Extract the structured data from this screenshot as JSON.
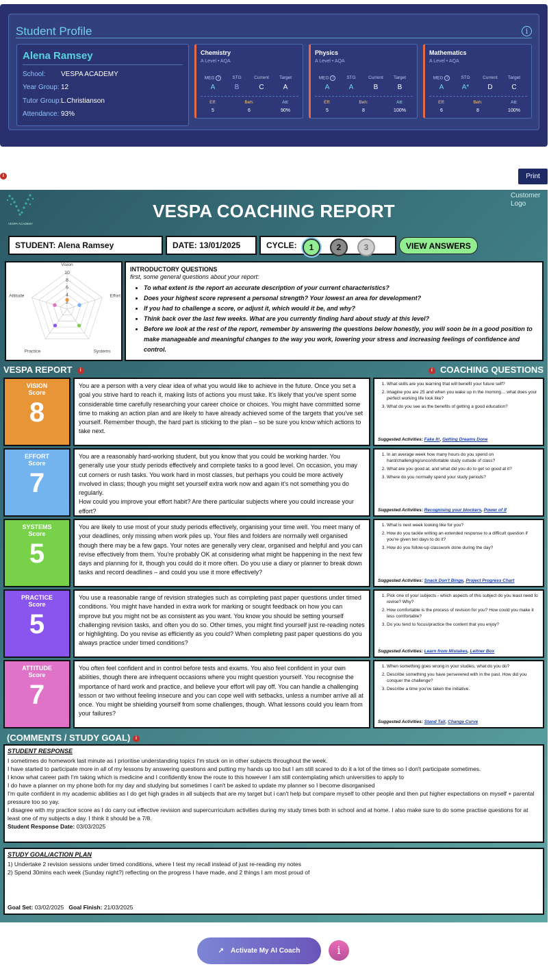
{
  "profile": {
    "title": "Student Profile",
    "name": "Alena Ramsey",
    "fields": [
      {
        "label": "School:",
        "value": "VESPA ACADEMY"
      },
      {
        "label": "Year Group:",
        "value": "12"
      },
      {
        "label": "Tutor Group:",
        "value": "L.Christianson"
      },
      {
        "label": "Attendance:",
        "value": "93%"
      }
    ],
    "headers": {
      "meg": "MEG",
      "stg": "STG",
      "current": "Current",
      "target": "Target",
      "eff": "Eff:",
      "beh": "Beh:",
      "att": "Att:"
    },
    "subjects": [
      {
        "name": "Chemistry",
        "level": "A Level • AQA",
        "meg": "A",
        "stg": "B",
        "current": "C",
        "target": "A",
        "eff": "5",
        "beh": "6",
        "att": "90%"
      },
      {
        "name": "Physics",
        "level": "A Level • AQA",
        "meg": "A",
        "stg": "A",
        "current": "B",
        "target": "B",
        "eff": "5",
        "beh": "8",
        "att": "100%"
      },
      {
        "name": "Mathematics",
        "level": "A Level • AQA",
        "meg": "A",
        "stg": "A*",
        "current": "D",
        "target": "C",
        "eff": "6",
        "beh": "8",
        "att": "100%"
      }
    ]
  },
  "print_label": "Print",
  "report": {
    "logo_text": "VESPA ACADEMY",
    "title": "VESPA COACHING REPORT",
    "customer_logo": "Customer Logo",
    "student_field": "STUDENT: Alena Ramsey",
    "date_field": "DATE: 13/01/2025",
    "cycle_label": "CYCLE:",
    "cycles": [
      "1",
      "2",
      "3"
    ],
    "view_answers": "VIEW ANSWERS",
    "intro": {
      "title": "INTRODUCTORY QUESTIONS",
      "subtitle": "first, some general questions about your report:",
      "questions": [
        "To what extent is the report an accurate description of your current characteristics?",
        "Does your highest score represent a personal strength? Your lowest an area for development?",
        "If you had to challenge a score, or adjust it, which would it be, and why?",
        "Think back over the last few weeks. What are you currently finding hard about study at this level?",
        "Before we look at the rest of the report, remember by answering the questions below honestly, you will soon be in a good position to make manageable and meaningful changes to the way you work, lowering your stress and increasing feelings of confidence and control."
      ]
    },
    "vespa_report_label": "VESPA REPORT",
    "coaching_questions_label": "COACHING QUESTIONS",
    "score_label": "Score",
    "suggested_label": "Suggested Activities:",
    "sections": [
      {
        "key": "vision",
        "title": "VISION",
        "score": "8",
        "color": "#e89538",
        "text": "You are a person with a very clear idea of what you would like to achieve in the future. Once you set a goal you strive hard to reach it, making lists of actions you must take. It's likely that you've spent some considerable time carefully researching your career choice or choices. You might have committed some time to making an action plan and are likely to have already achieved some of the targets that you've set yourself. Remember though, the hard part is sticking to the plan – so be sure you know which actions to take next.",
        "questions": [
          "What skills are you learning that will benefit your future self?",
          "Imagine you are 25 and when you wake up in the morning… what does your perfect working life look like?",
          "What do you see as the benefits of getting a good education?"
        ],
        "activities": [
          "Fake It!",
          "Getting Dreams Done"
        ]
      },
      {
        "key": "effort",
        "title": "EFFORT",
        "score": "7",
        "color": "#73b3f0",
        "text": "You are a reasonably hard-working student, but you know that you could be working harder. You generally use your study periods effectively and complete tasks to a good level. On occasion, you may cut corners or rush tasks. You work hard in most classes, but perhaps you could be more actively involved in class; though you might set yourself extra work now and again it's not something you do regularly.\nHow could you improve your effort habit? Are there particular subjects  where you could increase your effort?",
        "questions": [
          "In an average week how many hours do you spend on hard/challenging/uncomfortable study outside of class?",
          "What are you good at, and what did you do to get so good at it?",
          "Where do you normally spend your study periods?"
        ],
        "activities": [
          "Recognising your blockers",
          "Power of If"
        ]
      },
      {
        "key": "systems",
        "title": "SYSTEMS",
        "score": "5",
        "color": "#77d24a",
        "text": "You are likely to use most of your study periods effectively, organising your time well. You meet many of your deadlines, only missing when work piles up. Your files and folders are normally well organised though there may be a few gaps. Your notes are generally very clear, organised and helpful and you can revise effectively from them. You're probably OK at considering what might be happening in the next few days and planning for it, though you could do it more often. Do you use a diary or planner to break down tasks and record deadlines – and could you use it more effectively?",
        "questions": [
          "What is next week looking like for you?",
          "How do you tackle writing an extended response to a difficult question if you're given ten days to do it?",
          "How do you follow-up classwork done during the day?"
        ],
        "activities": [
          "Snack Don't Binge",
          "Project Progress Chart"
        ]
      },
      {
        "key": "practice",
        "title": "PRACTICE",
        "score": "5",
        "color": "#8a55ee",
        "text": "You use a reasonable range of revision strategies such as completing past paper questions under timed conditions. You might have handed in extra work for marking or sought feedback on how you can improve but you might not be as consistent as you want. You know you should be setting yourself challenging revision tasks, and often you do so. Other times, you might find yourself just re-reading notes or highlighting. Do you revise as efficiently as you could? When completing past paper questions do you always practice under timed conditions?",
        "questions": [
          "Pick one of your subjects - which aspects of this subject do you least need to revise? Why?",
          "How comfortable is the process of revision for you? How could you make it less comfortable?",
          "Do you tend to focus/practice the content that you enjoy?"
        ],
        "activities": [
          "Learn from Mistakes",
          "Leitner Box"
        ]
      },
      {
        "key": "attitude",
        "title": "ATTITUDE",
        "score": "7",
        "color": "#e072c8",
        "text": "You often feel confident and in control before tests and exams. You also feel confident in your own abilities, though there are infrequent occasions where you might question yourself. You recognise the importance of hard work and practice, and believe your effort will pay off. You can handle a challenging lesson or two without feeling insecure and you can cope well with setbacks, unless a number arrive all at once. You might be shielding yourself from some challenges, though. What lessons could you learn from your failures?",
        "questions": [
          "When something goes wrong in your studies, what do you do?",
          "Describe something you have persevered with in the past. How did you conquer the challenge?",
          "Describe a time you've taken the initiative."
        ],
        "activities": [
          "Stand Tall",
          "Change Curve"
        ]
      }
    ],
    "comments_label": "(COMMENTS / STUDY GOAL)",
    "student_response": {
      "heading": "STUDENT RESPONSE",
      "lines": [
        "I sometimes do homework last minute as I prioritise understanding topics I'm stuck on in other subjects throughout the week.",
        "I have started to participate more in all of my lessons by answering questions and putting my hands up too but I am still scared to do it a lot of the times so I don't participate sometimes.",
        "I know what career path I'm taking which is medicine and I confidently know the route to this however I am still contemplating which universities to apply to",
        "I do have a planner on my phone both for my day and studying but sometimes I can't be asked to update my planner so I become disorganised",
        "I'm quite confident in my academic abilities as I do get high grades in all subjects that are my target but i can't help but compare myself to other people and then put higher expectations on myself + parental pressure too so yay.",
        "I disagree with my practice score as I do carry out effective revision and supercurriculum activities during my study times both in school and at home. I also make sure to do some practise questions for at least one of my subjects a day. I think it should be a 7/8."
      ],
      "date_label": "Student Response Date:",
      "date": "03/03/2025"
    },
    "goal": {
      "heading": "STUDY GOAL/ACTION PLAN",
      "lines": [
        "1) Undertake 2 revision sessions under timed conditions, where I test my recall instead of just re-reading my notes",
        "2) Spend 30mins each week (Sunday night?) reflecting on the progress I have made, and 2 things I am most proud of"
      ],
      "set_label": "Goal Set:",
      "set": "03/02/2025",
      "finish_label": "Goal Finish:",
      "finish": "21/03/2025"
    },
    "radar": {
      "axes": [
        "Vision",
        "Effort",
        "Systems",
        "Practice",
        "Attitude"
      ],
      "ticks": [
        "10",
        "8",
        "6",
        "4",
        "2"
      ],
      "values": [
        8,
        7,
        5,
        5,
        7
      ],
      "max": 10,
      "colors": [
        "#e89538",
        "#73b3f0",
        "#77d24a",
        "#8a55ee",
        "#e072c8"
      ]
    }
  },
  "ai_coach_label": "Activate My AI Coach"
}
